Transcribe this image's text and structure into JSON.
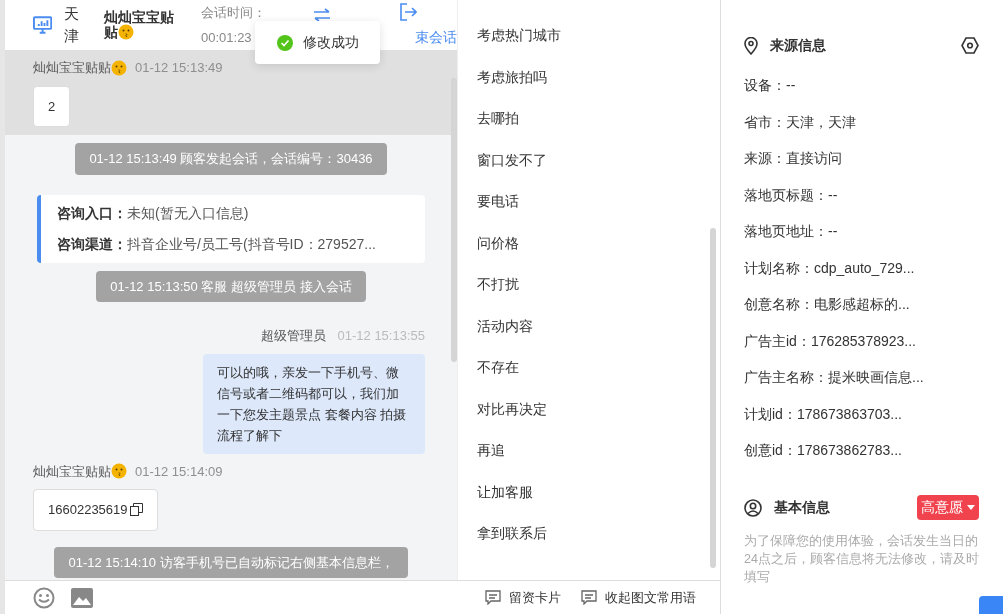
{
  "header": {
    "city": "天津",
    "visitor_name": "灿灿宝宝贴贴",
    "session_time_label": "会话时间：",
    "session_time": "00:01:23",
    "end_session_label": "束会话"
  },
  "toast": {
    "message": "修改成功"
  },
  "messages": [
    {
      "kind": "visitor",
      "sender": "灿灿宝宝贴贴",
      "time": "01-12 15:13:49",
      "content": "2",
      "highlighted": true,
      "copyable": false
    },
    {
      "kind": "system",
      "text": "01-12 15:13:49 顾客发起会话，会话编号：30436"
    },
    {
      "kind": "entry_card",
      "rows": [
        {
          "label": "咨询入口：",
          "value": "未知(暂无入口信息)"
        },
        {
          "label": "咨询渠道：",
          "value": "抖音企业号/员工号(抖音号ID：279527..."
        }
      ]
    },
    {
      "kind": "system",
      "text": "01-12 15:13:50 客服 超级管理员 接入会话"
    },
    {
      "kind": "agent",
      "sender": "超级管理员",
      "time": "01-12 15:13:55",
      "content": "可以的哦，亲发一下手机号、微信号或者二维码都可以，我们加一下您发主题景点 套餐内容 拍摄流程了解下"
    },
    {
      "kind": "visitor",
      "sender": "灿灿宝宝贴贴",
      "time": "01-12 15:14:09",
      "content": "16602235619",
      "highlighted": false,
      "copyable": true
    },
    {
      "kind": "system",
      "text": "01-12 15:14:10 访客手机号已自动标记右侧基本信息栏，"
    }
  ],
  "quick_phrases": [
    "考虑热门城市",
    "考虑旅拍吗",
    "去哪拍",
    "窗口发不了",
    "要电话",
    "问价格",
    "不打扰",
    "活动内容",
    "不存在",
    "对比再决定",
    "再追",
    "让加客服",
    "拿到联系后"
  ],
  "bottom_toolbar": {
    "buttons": [
      "留资卡片",
      "收起图文常用语"
    ]
  },
  "source_info": {
    "title": "来源信息",
    "fields": [
      "设备：--",
      "省市：天津，天津",
      "来源：直接访问",
      "落地页标题：--",
      "落地页地址：--",
      "计划名称：cdp_auto_729...",
      "创意名称：电影感超标的...",
      "广告主id：176285378923...",
      "广告主名称：提米映画信息...",
      "计划id：178673863703...",
      "创意id：178673862783..."
    ]
  },
  "basic_info": {
    "title": "基本信息",
    "intent_tag": "高意愿",
    "note": "为了保障您的使用体验，会话发生当日的24点之后，顾客信息将无法修改，请及时填写"
  }
}
